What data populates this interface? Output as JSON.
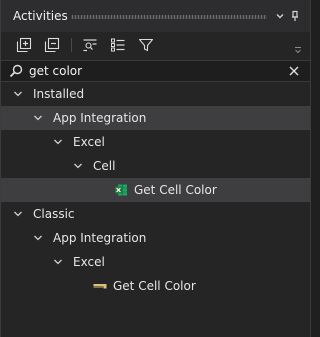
{
  "panel": {
    "title": "Activities"
  },
  "search": {
    "value": "get color"
  },
  "tree": {
    "installed_label": "Installed",
    "installed_app_integration": "App Integration",
    "installed_excel": "Excel",
    "installed_cell": "Cell",
    "installed_get_cell_color": "Get Cell Color",
    "classic_label": "Classic",
    "classic_app_integration": "App Integration",
    "classic_excel": "Excel",
    "classic_get_cell_color": "Get Cell Color"
  },
  "colors": {
    "panel_bg": "#252526",
    "titlebar_bg": "#2d2d30",
    "highlight_row": "#3e3e40",
    "excel_green": "#1d7a3a",
    "classic_icon_yellow": "#d9c27a"
  },
  "icons": {
    "expand_all": "expand-all-icon",
    "collapse_all": "collapse-all-icon",
    "filter": "filter-icon",
    "search": "search-icon",
    "clear": "close-icon",
    "pin": "pin-icon",
    "dropdown": "chevron-down-icon"
  }
}
